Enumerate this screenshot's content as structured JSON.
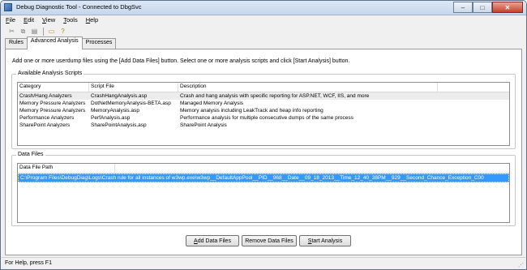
{
  "window": {
    "title": "Debug Diagnostic Tool - Connected to DbgSvc"
  },
  "titlebar_buttons": {
    "minimize": "–",
    "maximize": "□",
    "close": "✕"
  },
  "menu": [
    {
      "label": "File",
      "accel": "F",
      "rest": "ile"
    },
    {
      "label": "Edit",
      "accel": "E",
      "rest": "dit"
    },
    {
      "label": "View",
      "accel": "V",
      "rest": "iew"
    },
    {
      "label": "Tools",
      "accel": "T",
      "rest": "ools"
    },
    {
      "label": "Help",
      "accel": "H",
      "rest": "elp"
    }
  ],
  "toolbar": {
    "cut_icon": "✂",
    "copy_icon": "⧉",
    "paste_icon": "▤",
    "open_icon": "▭",
    "help_icon": "?"
  },
  "tabs": [
    {
      "label": "Rules",
      "active": false
    },
    {
      "label": "Advanced Analysis",
      "active": true
    },
    {
      "label": "Processes",
      "active": false
    }
  ],
  "instructions": "Add one or more userdump files using the [Add Data Files] button. Select one or more analysis scripts and click [Start Analysis] button.",
  "scripts_group": {
    "label": "Available Analysis Scripts",
    "columns": [
      "Category",
      "Script File",
      "Description"
    ],
    "rows": [
      [
        "Crash/Hang Analyzers",
        "CrashHangAnalysis.asp",
        "Crash and hang analysis with specific reporting for ASP.NET, WCF, IIS, and more"
      ],
      [
        "Memory Pressure Analyzers",
        "DotNetMemoryAnalysis-BETA.asp",
        "Managed Memory Analysis"
      ],
      [
        "Memory Pressure Analyzers",
        "MemoryAnalysis.asp",
        "Memory analysis including LeakTrack and heap info reporting"
      ],
      [
        "Performance Analyzers",
        "PerfAnalysis.asp",
        "Performance analysis for multiple consecutive dumps of the same process"
      ],
      [
        "SharePoint Analyzers",
        "SharePointAnalysis.asp",
        "SharePoint Analysis"
      ]
    ]
  },
  "data_group": {
    "label": "Data Files",
    "column": "Data File Path",
    "rows": [
      "C:\\Program Files\\DebugDiag\\Logs\\Crash rule for all instances of w3wp.exe\\w3wp__DefaultAppPool__PID__968__Date__09_18_2013__Time_12_40_38PM__929__Second_Chance_Exception_C00"
    ]
  },
  "buttons": {
    "add": {
      "accel": "A",
      "rest": "dd Data Files"
    },
    "remove": {
      "label": "Remove Data Files"
    },
    "start": {
      "accel": "S",
      "rest": "tart Analysis"
    }
  },
  "status": {
    "text": "For Help, press F1"
  }
}
